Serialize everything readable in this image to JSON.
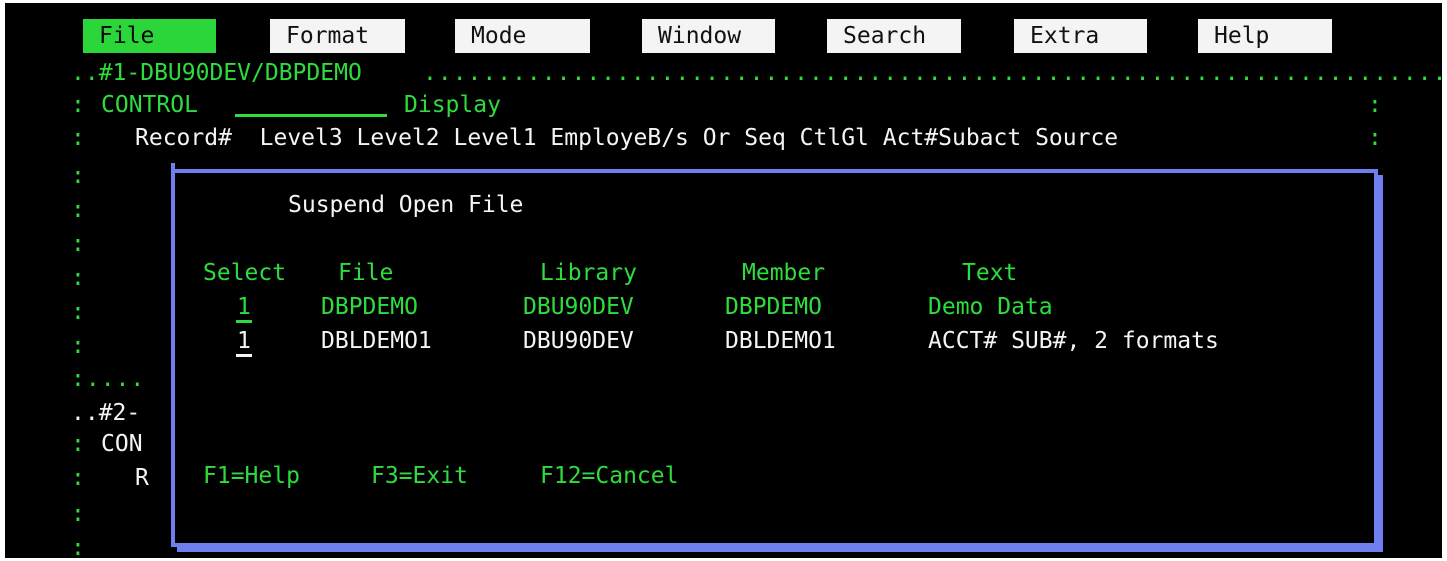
{
  "menu": [
    "File",
    "Format",
    "Mode",
    "Window",
    "Search",
    "Extra",
    "Help"
  ],
  "session1": {
    "title": "..#1-DBU90DEV/DBPDEMO",
    "control_label": "CONTROL",
    "display_label": "Display",
    "columns_header": "Record#  Level3 Level2 Level1 EmployeB/s Or Seq CtlGl Act#Subact Source"
  },
  "session2": {
    "title": "..#2-",
    "control_label": "CON",
    "record_label": "R"
  },
  "popup": {
    "title": "Suspend Open File",
    "headers": {
      "select": "Select",
      "file": "File",
      "library": "Library",
      "member": "Member",
      "text": "Text"
    },
    "rows": [
      {
        "select": "1",
        "file": "DBPDEMO",
        "library": "DBU90DEV",
        "member": "DBPDEMO",
        "text": "Demo Data"
      },
      {
        "select": "1",
        "file": "DBLDEMO1",
        "library": "DBU90DEV",
        "member": "DBLDEMO1",
        "text": "ACCT# SUB#, 2 formats"
      }
    ],
    "fkeys": [
      "F1=Help",
      "F3=Exit",
      "F12=Cancel"
    ]
  },
  "colors": {
    "green": "#2edc3e",
    "white": "#f4f4f4",
    "border": "#6f7ff0",
    "background": "#000000"
  }
}
